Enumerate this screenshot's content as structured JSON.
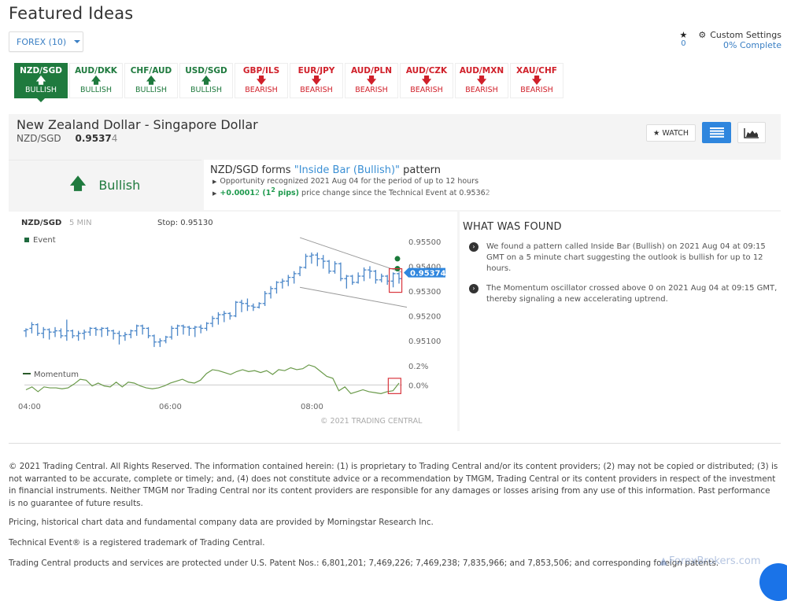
{
  "page": {
    "title": "Featured Ideas",
    "filter_label": "FOREX (10)"
  },
  "top_right": {
    "favorites_icon": "star-icon",
    "favorites_count": "0",
    "settings_icon": "gear-icon",
    "settings_label": "Custom Settings",
    "settings_progress": "0% Complete"
  },
  "tabs": [
    {
      "pair": "NZD/SGD",
      "direction": "BULLISH",
      "sentiment": "bull",
      "active": true
    },
    {
      "pair": "AUD/DKK",
      "direction": "BULLISH",
      "sentiment": "bull",
      "active": false
    },
    {
      "pair": "CHF/AUD",
      "direction": "BULLISH",
      "sentiment": "bull",
      "active": false
    },
    {
      "pair": "USD/SGD",
      "direction": "BULLISH",
      "sentiment": "bull",
      "active": false
    },
    {
      "pair": "GBP/ILS",
      "direction": "BEARISH",
      "sentiment": "bear",
      "active": false
    },
    {
      "pair": "EUR/JPY",
      "direction": "BEARISH",
      "sentiment": "bear",
      "active": false
    },
    {
      "pair": "AUD/PLN",
      "direction": "BEARISH",
      "sentiment": "bear",
      "active": false
    },
    {
      "pair": "AUD/CZK",
      "direction": "BEARISH",
      "sentiment": "bear",
      "active": false
    },
    {
      "pair": "AUD/MXN",
      "direction": "BEARISH",
      "sentiment": "bear",
      "active": false
    },
    {
      "pair": "XAU/CHF",
      "direction": "BEARISH",
      "sentiment": "bear",
      "active": false
    }
  ],
  "instrument": {
    "name": "New Zealand Dollar - Singapore Dollar",
    "symbol": "NZD/SGD",
    "price_main": "0.9537",
    "price_last_digit": "4",
    "watch_label": "WATCH"
  },
  "sentiment": {
    "label": "Bullish",
    "icon": "arrow-up-icon"
  },
  "pattern": {
    "prefix": "NZD/SGD forms ",
    "name": "\"Inside Bar (Bullish)\"",
    "suffix": " pattern",
    "line1": "Opportunity recognized 2021 Aug 04 for the period of up to 12 hours",
    "change_value_main": "+0.0001",
    "change_value_last": "2",
    "change_pips_open": " (1",
    "change_pips_sup": "2",
    "change_pips_close": " pips)",
    "line2_text": " price change since the Technical Event at 0.9536",
    "line2_last": "2"
  },
  "chart": {
    "symbol": "NZD/SGD",
    "interval": "5 MIN",
    "stop": "Stop: 0.95130",
    "legend_event": "Event",
    "legend_momentum": "Momentum",
    "current_price": "0.95374",
    "copyright": "© 2021 TRADING CENTRAL"
  },
  "chart_data": {
    "type": "ohlc",
    "price_axis": {
      "ticks": [
        "0.95500",
        "0.95400",
        "0.95300",
        "0.95200",
        "0.95100"
      ],
      "range": [
        0.9505,
        0.9555
      ]
    },
    "momentum_axis": {
      "ticks": [
        "0.2%",
        "0.0%"
      ],
      "range": [
        -0.12,
        0.25
      ]
    },
    "x_ticks": [
      "04:00",
      "06:00",
      "08:00"
    ],
    "current_price": 0.95374,
    "event_markers": [
      0.9543,
      0.9539
    ],
    "channel": {
      "upper": [
        [
          0.95515,
          0.95375
        ]
      ],
      "lower": [
        [
          0.95315,
          0.95235
        ]
      ]
    },
    "bars": [
      [
        0.9514,
        0.9515,
        0.95115,
        0.95145
      ],
      [
        0.9515,
        0.95175,
        0.9513,
        0.95165
      ],
      [
        0.95165,
        0.9517,
        0.9512,
        0.9513
      ],
      [
        0.9513,
        0.95155,
        0.9511,
        0.95145
      ],
      [
        0.95145,
        0.9515,
        0.95105,
        0.95135
      ],
      [
        0.95135,
        0.95155,
        0.95115,
        0.9514
      ],
      [
        0.9514,
        0.9515,
        0.9511,
        0.9512
      ],
      [
        0.9512,
        0.95185,
        0.951,
        0.9514
      ],
      [
        0.9514,
        0.95145,
        0.9511,
        0.9512
      ],
      [
        0.9512,
        0.9514,
        0.951,
        0.9513
      ],
      [
        0.9513,
        0.95145,
        0.95105,
        0.95135
      ],
      [
        0.95135,
        0.95155,
        0.9512,
        0.9515
      ],
      [
        0.9515,
        0.95155,
        0.9512,
        0.95145
      ],
      [
        0.95145,
        0.95155,
        0.95115,
        0.9515
      ],
      [
        0.9515,
        0.95155,
        0.9512,
        0.9514
      ],
      [
        0.9514,
        0.95145,
        0.95105,
        0.9513
      ],
      [
        0.9513,
        0.9514,
        0.95085,
        0.9512
      ],
      [
        0.9512,
        0.95135,
        0.951,
        0.95125
      ],
      [
        0.95125,
        0.95145,
        0.9511,
        0.9514
      ],
      [
        0.9514,
        0.95165,
        0.9512,
        0.9516
      ],
      [
        0.9516,
        0.95165,
        0.95125,
        0.9515
      ],
      [
        0.9515,
        0.95155,
        0.9511,
        0.9512
      ],
      [
        0.9512,
        0.95125,
        0.95075,
        0.95095
      ],
      [
        0.95095,
        0.9511,
        0.95075,
        0.951
      ],
      [
        0.951,
        0.9512,
        0.9509,
        0.95115
      ],
      [
        0.95115,
        0.9516,
        0.95105,
        0.9515
      ],
      [
        0.9515,
        0.95165,
        0.9512,
        0.9516
      ],
      [
        0.9516,
        0.95165,
        0.95125,
        0.95155
      ],
      [
        0.95155,
        0.9516,
        0.9512,
        0.9515
      ],
      [
        0.9515,
        0.9516,
        0.95115,
        0.95155
      ],
      [
        0.95155,
        0.95165,
        0.9513,
        0.9515
      ],
      [
        0.9515,
        0.95175,
        0.9514,
        0.9517
      ],
      [
        0.9517,
        0.952,
        0.95155,
        0.9519
      ],
      [
        0.9519,
        0.95215,
        0.95165,
        0.95205
      ],
      [
        0.95205,
        0.9522,
        0.95175,
        0.9521
      ],
      [
        0.9521,
        0.95215,
        0.95185,
        0.952
      ],
      [
        0.952,
        0.9526,
        0.95195,
        0.95255
      ],
      [
        0.95255,
        0.95265,
        0.95215,
        0.9525
      ],
      [
        0.9525,
        0.9527,
        0.9522,
        0.9524
      ],
      [
        0.9524,
        0.9525,
        0.9522,
        0.95235
      ],
      [
        0.95235,
        0.95255,
        0.9523,
        0.9525
      ],
      [
        0.9525,
        0.953,
        0.9524,
        0.9529
      ],
      [
        0.9529,
        0.9532,
        0.9527,
        0.9531
      ],
      [
        0.9531,
        0.9534,
        0.9529,
        0.95335
      ],
      [
        0.95335,
        0.9535,
        0.9531,
        0.9534
      ],
      [
        0.9534,
        0.95365,
        0.9532,
        0.95355
      ],
      [
        0.95355,
        0.9538,
        0.9533,
        0.9537
      ],
      [
        0.9537,
        0.954,
        0.9536,
        0.95395
      ],
      [
        0.95395,
        0.9545,
        0.9539,
        0.9544
      ],
      [
        0.9544,
        0.95455,
        0.9541,
        0.95445
      ],
      [
        0.95445,
        0.95455,
        0.954,
        0.9543
      ],
      [
        0.9543,
        0.95445,
        0.9539,
        0.9542
      ],
      [
        0.9542,
        0.95425,
        0.9537,
        0.9538
      ],
      [
        0.9538,
        0.9542,
        0.9537,
        0.9541
      ],
      [
        0.9541,
        0.95415,
        0.9534,
        0.9535
      ],
      [
        0.9535,
        0.95365,
        0.9531,
        0.9536
      ],
      [
        0.9536,
        0.95365,
        0.95325,
        0.95335
      ],
      [
        0.95335,
        0.95375,
        0.9533,
        0.9536
      ],
      [
        0.9536,
        0.95395,
        0.9534,
        0.95385
      ],
      [
        0.95385,
        0.954,
        0.9535,
        0.9538
      ],
      [
        0.9538,
        0.95385,
        0.9533,
        0.95345
      ],
      [
        0.95345,
        0.9537,
        0.95335,
        0.9536
      ],
      [
        0.9536,
        0.95365,
        0.95325,
        0.9534
      ],
      [
        0.9534,
        0.95375,
        0.95315,
        0.9537
      ],
      [
        0.9537,
        0.95375,
        0.9533,
        0.9535
      ]
    ],
    "momentum": [
      -0.05,
      -0.02,
      -0.07,
      -0.02,
      -0.03,
      -0.03,
      -0.04,
      -0.03,
      0.01,
      0.06,
      0.05,
      -0.01,
      0.02,
      -0.01,
      -0.02,
      0.03,
      -0.02,
      0.03,
      0.02,
      -0.01,
      -0.03,
      -0.04,
      -0.03,
      -0.01,
      0.02,
      0.04,
      0.06,
      0.03,
      0.02,
      0.05,
      0.12,
      0.16,
      0.15,
      0.13,
      0.11,
      0.14,
      0.16,
      0.14,
      0.15,
      0.13,
      0.15,
      0.11,
      0.16,
      0.15,
      0.18,
      0.16,
      0.17,
      0.21,
      0.19,
      0.14,
      0.09,
      0.07,
      -0.06,
      -0.02,
      -0.09,
      -0.07,
      -0.05,
      -0.07,
      -0.08,
      -0.09,
      -0.07,
      -0.06,
      0.02
    ]
  },
  "found": {
    "title": "WHAT WAS FOUND",
    "items": [
      "We found a pattern called Inside Bar (Bullish) on 2021 Aug 04 at 09:15 GMT on a 5 minute chart suggesting the outlook is bullish for up to 12 hours.",
      "The Momentum oscillator crossed above 0 on 2021 Aug 04 at 09:15 GMT, thereby signaling a new accelerating uptrend."
    ]
  },
  "footer": {
    "disclaimer": "© 2021 Trading Central. All Rights Reserved. The information contained herein: (1) is proprietary to Trading Central and/or its content providers; (2) may not be copied or distributed; (3) is not warranted to be accurate, complete or timely; and, (4) does not constitute advice or a recommendation by TMGM, Trading Central or its content providers in respect of the investment in financial instruments. Neither TMGM nor Trading Central nor its content providers are responsible for any damages or losses arising from any use of this information. Past performance is no guarantee of future results.",
    "pricing": "Pricing, historical chart data and fundamental company data are provided by Morningstar Research Inc.",
    "trademark": "Technical Event® is a registered trademark of Trading Central.",
    "patents": "Trading Central products and services are protected under U.S. Patent Nos.: 6,801,201; 7,469,226; 7,469,238; 7,835,966; and 7,853,506; and corresponding foreign patents.",
    "watermark": "ForexBrokers.com"
  },
  "colors": {
    "bull": "#1f7a3e",
    "bear": "#d0202a",
    "accent": "#2f86de",
    "bar": "#4a86c8",
    "momentum": "#6a9a4a"
  }
}
